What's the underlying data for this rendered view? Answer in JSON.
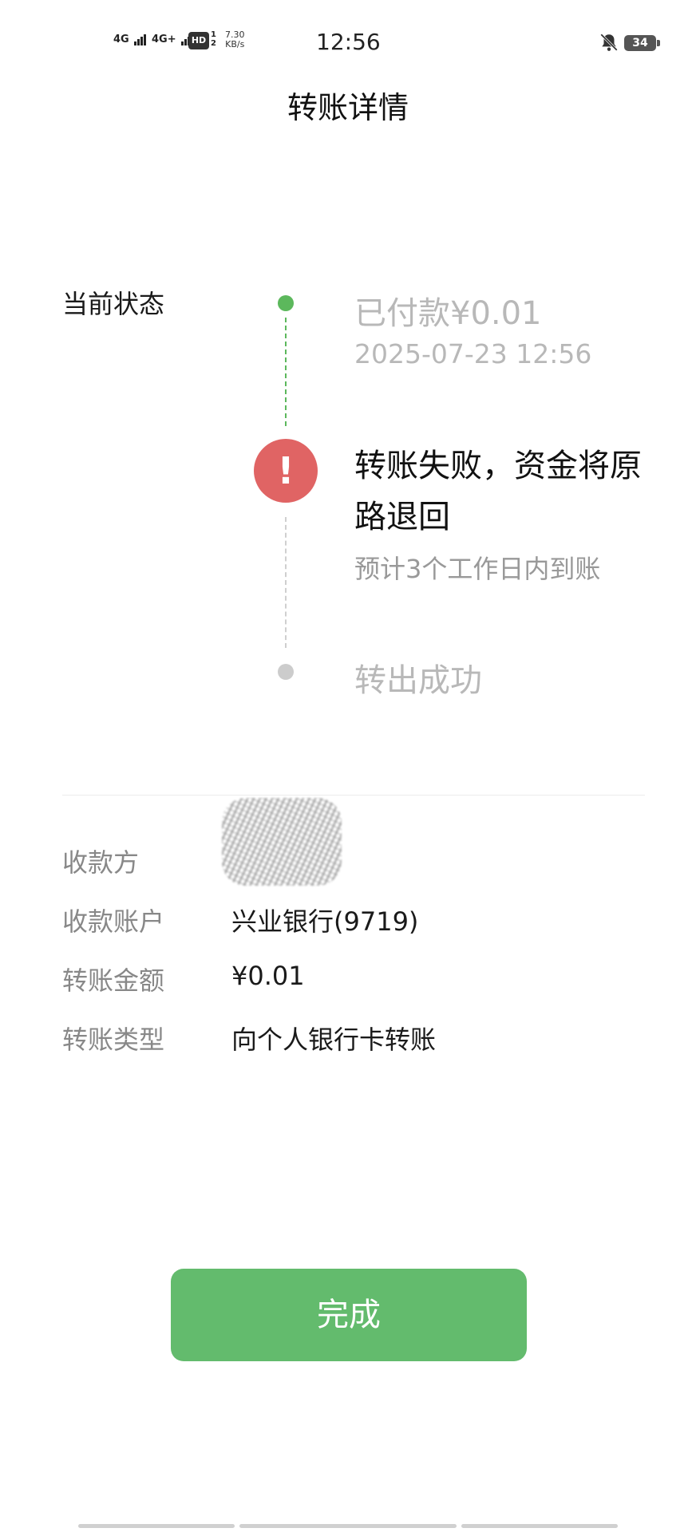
{
  "status_bar": {
    "sim1": "4G",
    "sim2": "4G+",
    "hd": "HD",
    "hd_nums": "1\n2",
    "net_speed": "7.30",
    "net_unit": "KB/s",
    "time": "12:56",
    "battery": "34",
    "icons": [
      "signal-icon",
      "hd-icon",
      "bell-off-icon",
      "battery-icon"
    ]
  },
  "header": {
    "title": "转账详情"
  },
  "status": {
    "label": "当前状态",
    "steps": [
      {
        "title": "已付款¥0.01",
        "time": "2025-07-23 12:56",
        "state": "done"
      },
      {
        "title": "转账失败，资金将原路退回",
        "sub": "预计3个工作日内到账",
        "state": "failed",
        "icon": "!"
      },
      {
        "title": "转出成功",
        "state": "pending"
      }
    ]
  },
  "details": [
    {
      "label": "收款方",
      "value": ""
    },
    {
      "label": "收款账户",
      "value": "兴业银行(9719)"
    },
    {
      "label": "转账金额",
      "value": "¥0.01"
    },
    {
      "label": "转账类型",
      "value": "向个人银行卡转账"
    }
  ],
  "actions": {
    "done_label": "完成"
  },
  "colors": {
    "green": "#5cb85c",
    "button": "#63bb6d",
    "error": "#e06464",
    "muted": "#b8b8b8"
  }
}
